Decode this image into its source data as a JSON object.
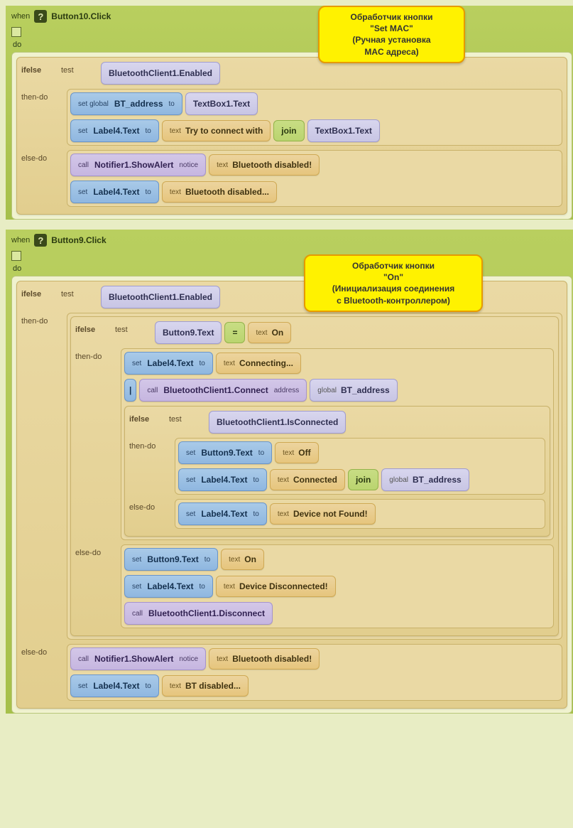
{
  "comments": {
    "c1_l1": "Обработчик кнопки",
    "c1_l2": "\"Set MAC\"",
    "c1_l3": "(Ручная установка",
    "c1_l4": "MAC адреса)",
    "c2_l1": "Обработчик кнопки",
    "c2_l2": "\"On\"",
    "c2_l3": "(Инициализация соединения",
    "c2_l4": "с Bluetooth-контроллером)"
  },
  "kw": {
    "when": "when",
    "do": "do",
    "ifelse": "ifelse",
    "test": "test",
    "then_do": "then-do",
    "else_do": "else-do",
    "set": "set",
    "set_global": "set global",
    "to": "to",
    "call": "call",
    "notice": "notice",
    "text": "text",
    "join": "join",
    "global": "global",
    "address": "address",
    "eq": "="
  },
  "ev": {
    "btn10": "Button10.Click",
    "btn9": "Button9.Click"
  },
  "get": {
    "bt_enabled": "BluetoothClient1.Enabled",
    "tb1_text": "TextBox1.Text",
    "btn9_text": "Button9.Text",
    "bt_isconn": "BluetoothClient1.IsConnected",
    "bt_addr": "BT_address"
  },
  "target": {
    "global_btaddr": "BT_address",
    "label4": "Label4.Text",
    "btn9": "Button9.Text"
  },
  "calls": {
    "notifier": "Notifier1.ShowAlert",
    "bt_connect": "BluetoothClient1.Connect",
    "bt_disconnect": "BluetoothClient1.Disconnect"
  },
  "lit": {
    "try_connect": "Try to connect with",
    "bt_disabled_bang": "Bluetooth disabled!",
    "bt_disabled_dots": "Bluetooth disabled...",
    "on": "On",
    "off": "Off",
    "connecting": "Connecting...",
    "connected": "Connected",
    "dev_not_found": "Device not Found!",
    "dev_disconnected": "Device Disconnected!",
    "bt_short_disabled": "BT disabled..."
  },
  "misc": {
    "pipe": "|"
  }
}
